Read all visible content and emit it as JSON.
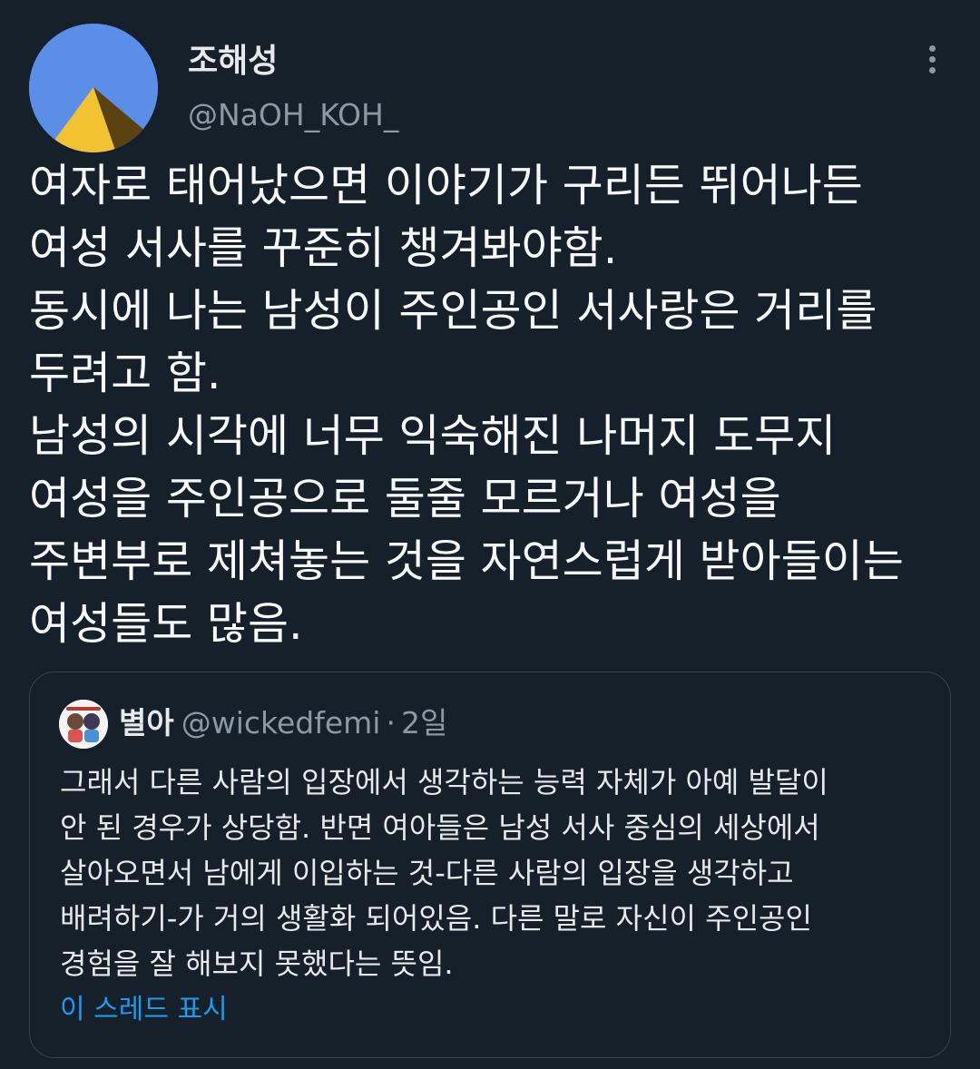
{
  "author": {
    "display_name": "조해성",
    "handle": "@NaOH_KOH_",
    "avatar_icon": "pyramid-avatar"
  },
  "tweet": {
    "lines": [
      "여자로 태어났으면 이야기가 구리든 뛰어나든",
      "여성 서사를 꾸준히 챙겨봐야함.",
      "동시에 나는 남성이 주인공인 서사랑은 거리를",
      "두려고 함.",
      "남성의 시각에 너무 익숙해진 나머지 도무지",
      "여성을 주인공으로 둘줄 모르거나 여성을",
      "주변부로 제쳐놓는 것을 자연스럽게 받아들이는",
      "여성들도 많음."
    ]
  },
  "quote": {
    "display_name": "별아",
    "handle": "@wickedfemi",
    "separator": "·",
    "date": "2일",
    "lines": [
      "그래서 다른 사람의 입장에서 생각하는 능력 자체가 아예 발달이",
      "안 된 경우가 상당함. 반면 여아들은 남성 서사 중심의 세상에서",
      "살아오면서 남에게 이입하는 것-다른 사람의 입장을 생각하고",
      "배려하기-가 거의 생활화 되어있음. 다른 말로 자신이 주인공인",
      "경험을 잘 해보지 못했다는 뜻임."
    ],
    "show_thread": "이 스레드 표시"
  },
  "colors": {
    "background": "#15202b",
    "text": "#f7f9f9",
    "secondary": "#8b98a5",
    "link": "#1d9bf0",
    "border": "#38444d"
  }
}
